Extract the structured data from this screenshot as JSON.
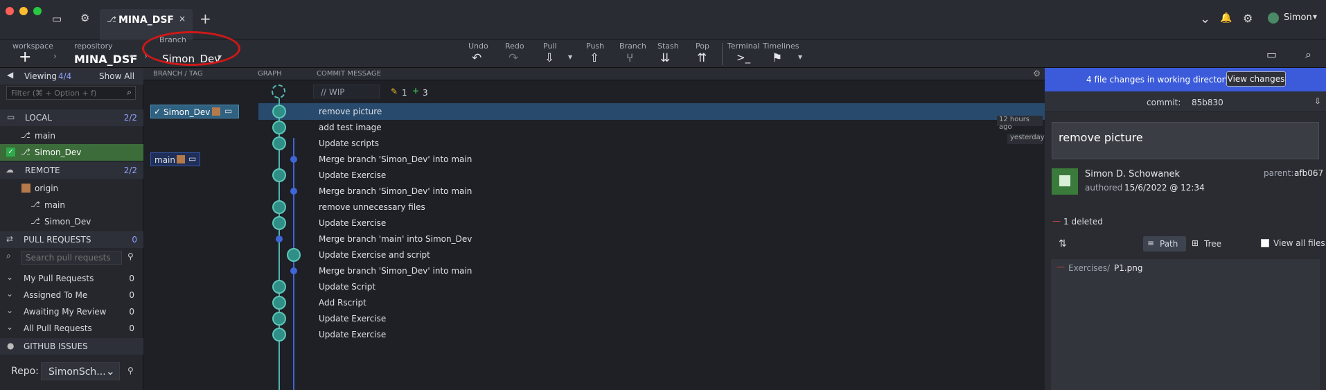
{
  "window": {
    "tab_title": "MINA_DSF",
    "user": "Simon"
  },
  "toolbar": {
    "workspace": "workspace",
    "repository": "repository",
    "repository_name": "MINA_DSF",
    "branch_label": "Branch",
    "branch_name": "Simon_Dev",
    "undo": "Undo",
    "redo": "Redo",
    "pull": "Pull",
    "push": "Push",
    "branch": "Branch",
    "stash": "Stash",
    "pop": "Pop",
    "terminal": "Terminal",
    "timelines": "Timelines"
  },
  "sidebar": {
    "viewing": "Viewing",
    "viewing_count": "4/4",
    "show_all": "Show All",
    "filter_placeholder": "Filter (⌘ + Option + f)",
    "local": "LOCAL",
    "local_count": "2/2",
    "local_items": [
      "main",
      "Simon_Dev"
    ],
    "remote": "REMOTE",
    "remote_count": "2/2",
    "origin": "origin",
    "remote_items": [
      "main",
      "Simon_Dev"
    ],
    "pull_requests": "PULL REQUESTS",
    "pull_requests_count": "0",
    "search_pull_requests": "Search pull requests",
    "pr_items": [
      {
        "label": "My Pull Requests",
        "count": "0"
      },
      {
        "label": "Assigned To Me",
        "count": "0"
      },
      {
        "label": "Awaiting My Review",
        "count": "0"
      },
      {
        "label": "All Pull Requests",
        "count": "0"
      }
    ],
    "github_issues": "GITHUB ISSUES",
    "repo_label": "Repo:",
    "repo_value": "SimonSch..."
  },
  "graph": {
    "columns": {
      "branch_tag": "BRANCH / TAG",
      "graph": "GRAPH",
      "message": "COMMIT MESSAGE"
    },
    "wip": "// WIP",
    "wip_edit_count": "1",
    "wip_add_count": "3",
    "branch_labels": {
      "simon": "Simon_Dev",
      "main": "main"
    },
    "time_labels": {
      "t1": "12 hours ago",
      "t2": "yesterday"
    },
    "commits": [
      "remove picture",
      "add test image",
      "Update scripts",
      "Merge branch 'Simon_Dev' into main",
      "Update Exercise",
      "Merge branch 'Simon_Dev' into main",
      "remove unnecessary files",
      "Update Exercise",
      "Merge branch 'main' into Simon_Dev",
      "Update Exercise and script",
      "Merge branch 'Simon_Dev' into main",
      "Update Script",
      "Add Rscript",
      "Update Exercise",
      "Update Exercise"
    ]
  },
  "details": {
    "banner": "4 file changes in working directory",
    "view_changes": "View changes",
    "commit_label": "commit:",
    "commit_hash": "85b830",
    "message": "remove picture",
    "author": "Simon D. Schowanek",
    "authored": "authored",
    "date": "15/6/2022 @ 12:34",
    "parent_label": "parent:",
    "parent_hash": "afb067",
    "deleted": "1 deleted",
    "path": "Path",
    "tree": "Tree",
    "view_all_files": "View all files",
    "file_dir": "Exercises/",
    "file_name": "P1.png"
  },
  "colors": {
    "accent": "#3b5bdb",
    "teal": "#4fb3b0",
    "highlight": "#294b6b",
    "danger": "#d64545"
  }
}
